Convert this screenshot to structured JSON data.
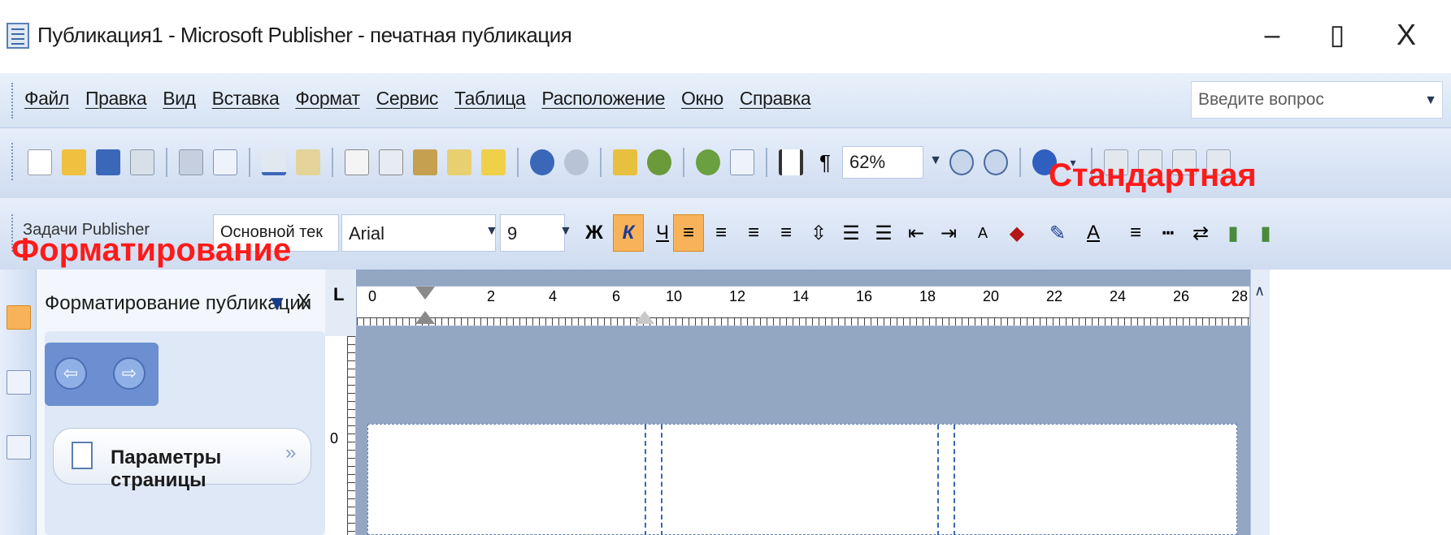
{
  "window": {
    "title": "Публикация1 - Microsoft Publisher - печатная публикация",
    "min": "–",
    "max": "▯",
    "close": "X"
  },
  "menubar": {
    "items": [
      "Файл",
      "Правка",
      "Вид",
      "Вставка",
      "Формат",
      "Сервис",
      "Таблица",
      "Расположение",
      "Окно",
      "Справка"
    ],
    "help_placeholder": "Введите вопрос"
  },
  "toolbar_standard": {
    "zoom_value": "62%",
    "overlay_label": "Стандартная"
  },
  "toolbar_format": {
    "tasks_label": "Задачи Publisher",
    "style_value": "Основной тек",
    "font_value": "Arial",
    "size_value": "9",
    "bold": "Ж",
    "italic": "К",
    "underline": "Ч",
    "overlay_label": "Форматирование"
  },
  "taskpane": {
    "title": "Форматирование публикации",
    "close": "X",
    "dropdown": "▼",
    "section_label": "Параметры страницы",
    "nav_back": "⇦",
    "nav_forward": "⇨"
  },
  "ruler": {
    "corner": "L",
    "ticks": [
      "0",
      "2",
      "4",
      "6",
      "10",
      "12",
      "14",
      "16",
      "18",
      "20",
      "22",
      "24",
      "26",
      "28"
    ]
  }
}
